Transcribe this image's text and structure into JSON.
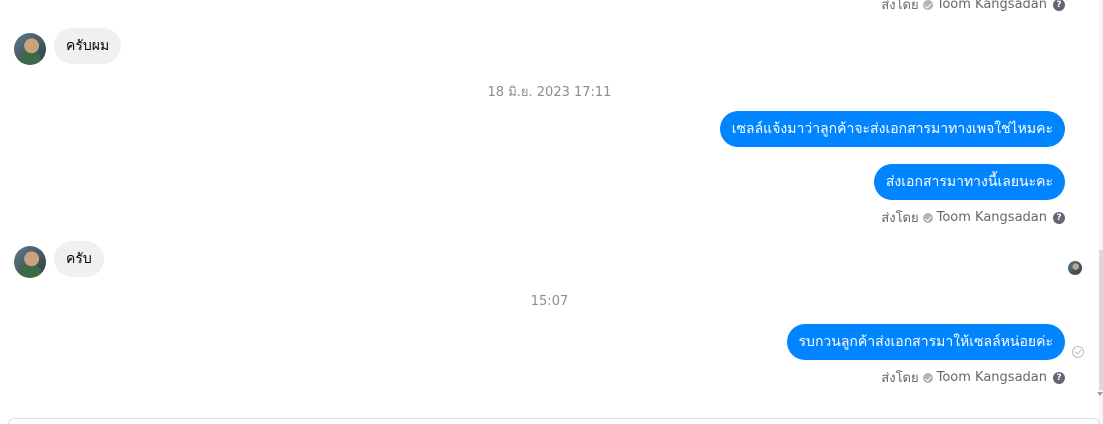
{
  "sent_by": {
    "prefix": "ส่งโดย",
    "name": "Toom Kangsadan"
  },
  "messages": {
    "m1_in": "ครับผม",
    "timestamp_1": "18 มิ.ย. 2023 17:11",
    "m2_out": "เซลล์แจ้งมาว่าลูกค้าจะส่งเอกสารมาทางเพจใช่ไหมคะ",
    "m3_out": "ส่งเอกสารมาทางนี้เลยนะคะ",
    "m4_in": "ครับ",
    "timestamp_2": "15:07",
    "m5_out": "รบกวนลูกค้าส่งเอกสารมาให้เซลล์หน่อยค่ะ"
  },
  "icons": {
    "help": "?",
    "verified": "check-shield",
    "seen": "contact-avatar"
  },
  "colors": {
    "outgoing_bubble": "#0084ff",
    "incoming_bubble": "#f0f0f0",
    "meta_text": "#65676b"
  }
}
